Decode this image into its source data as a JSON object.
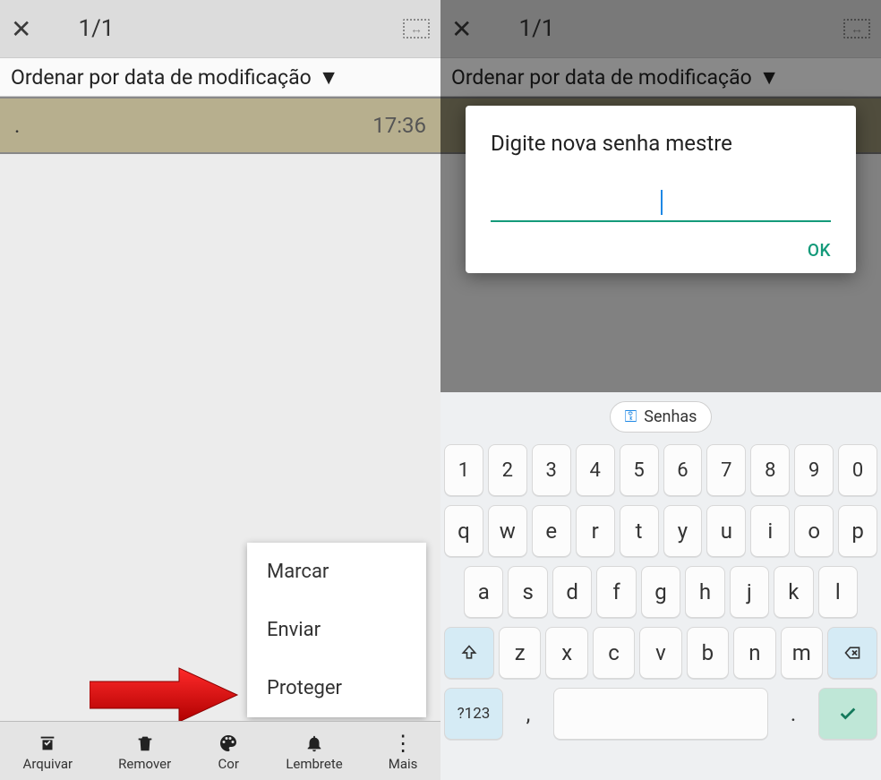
{
  "left": {
    "topbar": {
      "count": "1/1"
    },
    "sort_label": "Ordenar por data de modificação",
    "note": {
      "title": ".",
      "time": "17:36"
    },
    "menu": {
      "mark": "Marcar",
      "send": "Enviar",
      "protect": "Proteger"
    },
    "toolbar": {
      "archive": "Arquivar",
      "remove": "Remover",
      "color": "Cor",
      "reminder": "Lembrete",
      "more": "Mais"
    }
  },
  "right": {
    "topbar": {
      "count": "1/1"
    },
    "sort_label": "Ordenar por data de modificação",
    "dialog": {
      "title": "Digite nova senha mestre",
      "ok": "OK"
    },
    "chip": "Senhas",
    "keys": {
      "nums": [
        "1",
        "2",
        "3",
        "4",
        "5",
        "6",
        "7",
        "8",
        "9",
        "0"
      ],
      "r1": [
        "q",
        "w",
        "e",
        "r",
        "t",
        "y",
        "u",
        "i",
        "o",
        "p"
      ],
      "r2": [
        "a",
        "s",
        "d",
        "f",
        "g",
        "h",
        "j",
        "k",
        "l"
      ],
      "r3": [
        "z",
        "x",
        "c",
        "v",
        "b",
        "n",
        "m"
      ],
      "sym": "?123",
      "comma": ",",
      "dot": "."
    }
  }
}
